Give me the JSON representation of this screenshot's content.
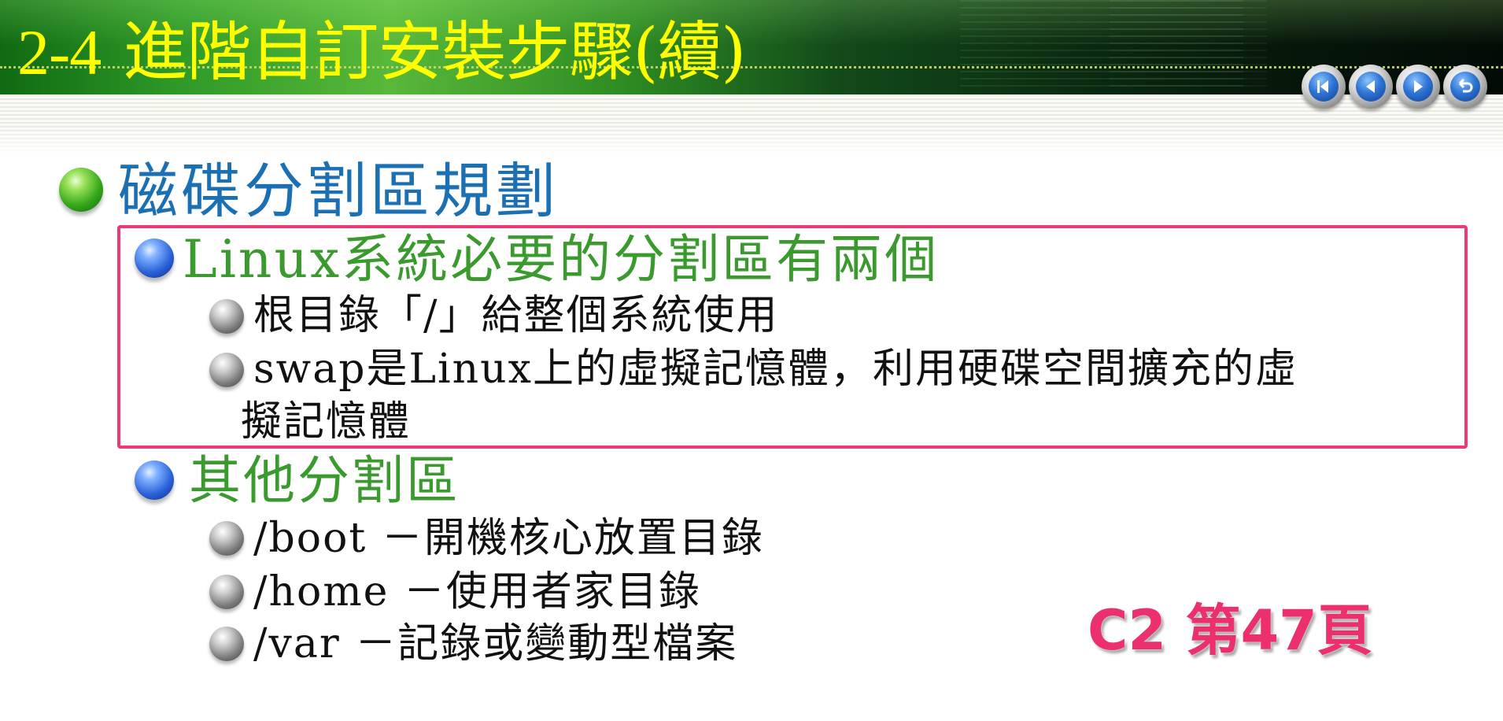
{
  "slide": {
    "section_number": "2-4",
    "title": "進階自訂安裝步驟(續)"
  },
  "nav_buttons": [
    {
      "icon": "rewind-icon"
    },
    {
      "icon": "back-icon"
    },
    {
      "icon": "forward-icon"
    },
    {
      "icon": "return-icon"
    }
  ],
  "content": {
    "heading": "磁碟分割區規劃",
    "required": {
      "label": "Linux系統必要的分割區有兩個",
      "items": [
        "根目錄「/」給整個系統使用",
        "swap是Linux上的虛擬記憶體，利用硬碟空間擴充的虛",
        "擬記憶體"
      ]
    },
    "other": {
      "label": "其他分割區",
      "items": [
        "/boot －開機核心放置目錄",
        "/home －使用者家目錄",
        "/var －記錄或變動型檔案"
      ]
    }
  },
  "page_reference": "C2 第47頁",
  "colors": {
    "title": "#ffff00",
    "heading": "#1b6fb3",
    "subheading": "#3a9a2e",
    "body": "#111111",
    "highlight_border": "#ee3a74",
    "page_reference": "#ec2f6d"
  }
}
